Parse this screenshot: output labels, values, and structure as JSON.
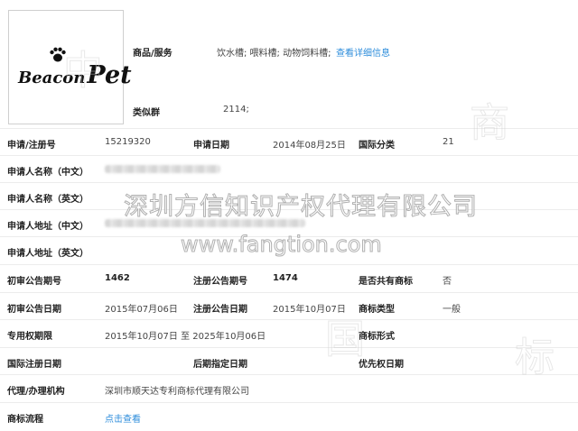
{
  "brand": {
    "logo_word1": "Beacon",
    "logo_word2": "Pet"
  },
  "goods": {
    "label": "商品/服务",
    "value": "饮水槽; 喂料槽; 动物饲料槽;",
    "link": "查看详细信息",
    "group_label": "类似群",
    "group_value": "2114;"
  },
  "rows": {
    "reg_no_label": "申请/注册号",
    "reg_no": "15219320",
    "apply_date_label": "申请日期",
    "apply_date": "2014年08月25日",
    "intl_class_label": "国际分类",
    "intl_class": "21",
    "applicant_cn_label": "申请人名称（中文）",
    "applicant_en_label": "申请人名称（英文）",
    "address_cn_label": "申请人地址（中文）",
    "address_en_label": "申请人地址（英文）",
    "prelim_no_label": "初审公告期号",
    "prelim_no": "1462",
    "reg_notice_no_label": "注册公告期号",
    "reg_notice_no": "1474",
    "shared_label": "是否共有商标",
    "shared": "否",
    "prelim_date_label": "初审公告日期",
    "prelim_date": "2015年07月06日",
    "reg_notice_date_label": "注册公告日期",
    "reg_notice_date": "2015年10月07日",
    "mark_type_label": "商标类型",
    "mark_type": "一般",
    "exclusive_label": "专用权期限",
    "exclusive": "2015年10月07日 至 2025年10月06日",
    "mark_form_label": "商标形式",
    "intl_reg_date_label": "国际注册日期",
    "later_date_label": "后期指定日期",
    "priority_date_label": "优先权日期",
    "agent_label": "代理/办理机构",
    "agent": "深圳市顺天达专利商标代理有限公司",
    "flow_label": "商标流程",
    "flow_link": "点击查看"
  },
  "watermark": {
    "company": "深圳方信知识产权代理有限公司",
    "url": "www.fangtion.com",
    "chars": [
      "中",
      "国",
      "商",
      "标"
    ]
  }
}
